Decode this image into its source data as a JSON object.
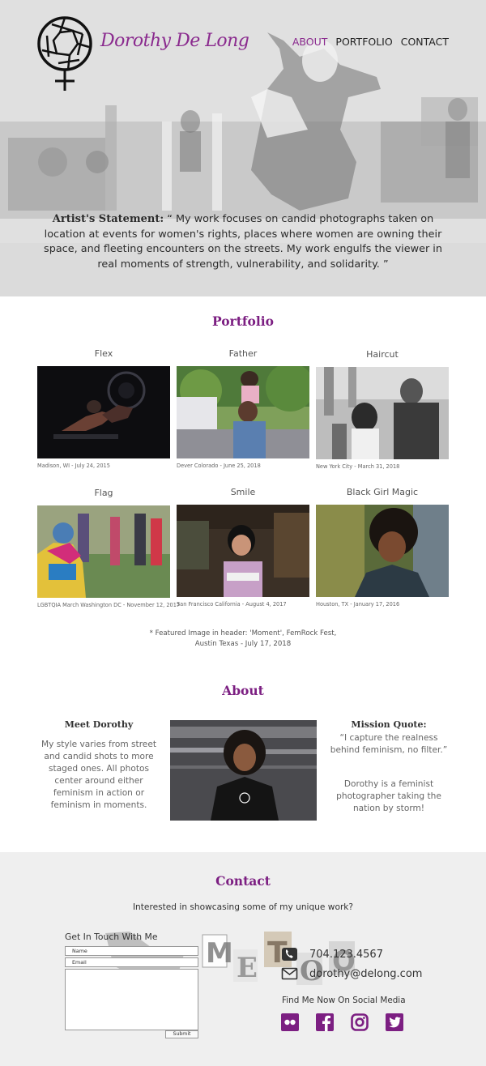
{
  "header": {
    "brand": "Dorothy De Long",
    "nav": [
      "ABOUT",
      "PORTFOLIO",
      "CONTACT"
    ],
    "statement_label": "Artist's Statement:",
    "statement_text": " “ My work focuses on candid photographs taken on location at events for women's rights, places where women are owning their space, and fleeting encounters on the streets. My work engulfs the viewer in real moments of strength, vulnerability, and solidarity. ”"
  },
  "portfolio": {
    "title": "Portfolio",
    "items": [
      {
        "title": "Flex",
        "caption": "Madison, WI - July 24, 2015"
      },
      {
        "title": "Father",
        "caption": "Dever Colorado - June 25, 2018"
      },
      {
        "title": "Haircut",
        "caption": "New York City - March 31, 2018"
      },
      {
        "title": "Flag",
        "caption": "LGBTQIA March Washington DC - November 12, 2017"
      },
      {
        "title": "Smile",
        "caption": "San Francisco California - August 4, 2017"
      },
      {
        "title": "Black Girl Magic",
        "caption": "Houston, TX - January 17, 2016"
      }
    ],
    "featured_line1": "* Featured Image in header: 'Moment', FemRock Fest,",
    "featured_line2": "Austin Texas - July 17, 2018"
  },
  "about": {
    "title": "About",
    "meet_title": "Meet Dorothy",
    "meet_text": "My style varies from street and candid shots to more staged ones. All photos center around either feminism in action or feminism in moments.",
    "quote_title": "Mission Quote:",
    "quote_text": "“I capture the realness behind feminism, no filter.”",
    "bio_text": "Dorothy is a feminist photographer taking the nation by storm!"
  },
  "contact": {
    "title": "Contact",
    "lead": "Interested in showcasing some of my unique work?",
    "form_title": "Get In Touch With Me",
    "name_placeholder": "Name",
    "email_placeholder": "Email",
    "submit_label": "Submit",
    "phone": "704.123.4567",
    "email": "dorothy@delong.com",
    "social_title": "Find Me Now On Social Media",
    "social_icons": [
      "flickr-icon",
      "facebook-icon",
      "instagram-icon",
      "twitter-icon"
    ]
  },
  "colors": {
    "accent": "#8a2a8e",
    "accent_dark": "#7c1f82",
    "text": "#444444"
  }
}
